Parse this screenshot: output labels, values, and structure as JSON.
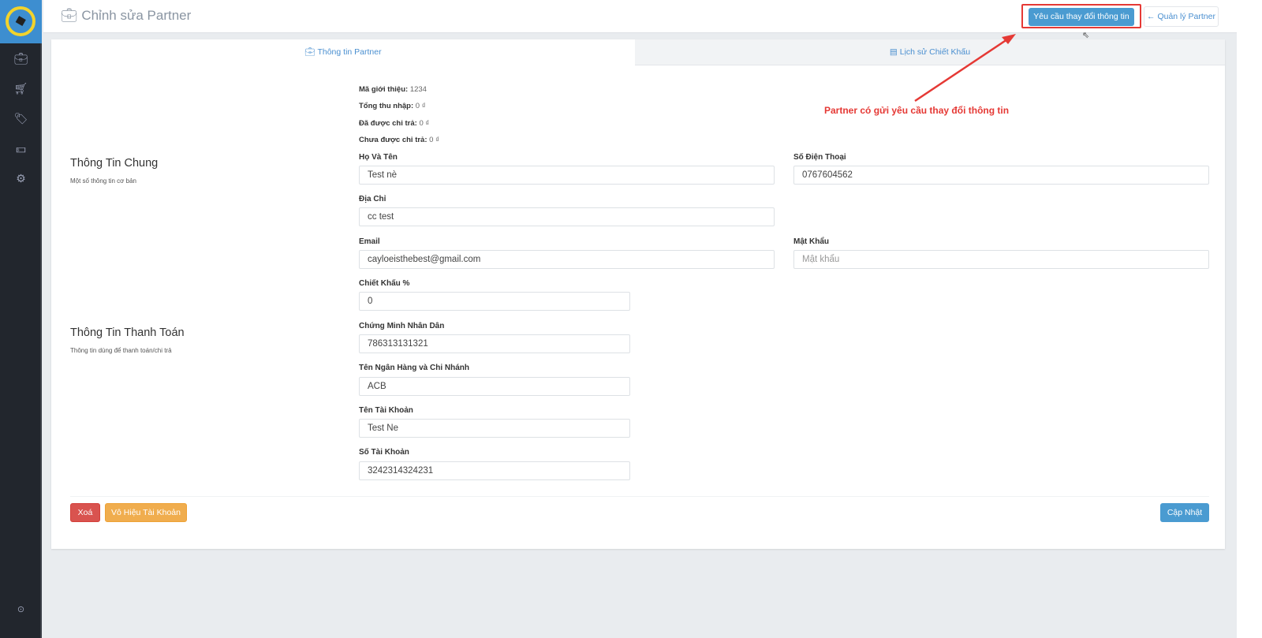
{
  "header": {
    "title": "Chỉnh sửa Partner",
    "request_button": "Yêu cầu thay đổi thông tin",
    "back_button": "Quản lý Partner"
  },
  "sidebar": {
    "items": [
      "briefcase-icon",
      "cart-icon",
      "tags-icon",
      "money-icon",
      "cogs-icon"
    ]
  },
  "tabs": [
    {
      "label": "Thông tin Partner"
    },
    {
      "label": "Lịch sử Chiết Khấu"
    }
  ],
  "annotation": "Partner có gửi yêu cầu thay đổi thông tin",
  "sections": {
    "general": {
      "title": "Thông Tin Chung",
      "subtitle": "Một số thông tin cơ bản"
    },
    "payment": {
      "title": "Thông Tin Thanh Toán",
      "subtitle": "Thông tin dùng để thanh toán/chi trả"
    }
  },
  "info": {
    "referral_label": "Mã giới thiệu:",
    "referral": "1234",
    "income_label": "Tổng thu nhập:",
    "income": "0 ₫",
    "paid_label": "Đã được chi trả:",
    "paid": "0 ₫",
    "unpaid_label": "Chưa được chi trả:",
    "unpaid": "0 ₫"
  },
  "fields": {
    "name": {
      "label": "Họ Và Tên",
      "value": "Test nè"
    },
    "phone": {
      "label": "Số Điện Thoại",
      "value": "0767604562"
    },
    "address": {
      "label": "Địa Chỉ",
      "value": "cc test"
    },
    "email": {
      "label": "Email",
      "value": "cayloeisthebest@gmail.com"
    },
    "password": {
      "label": "Mật Khẩu",
      "placeholder": "Mật khẩu"
    },
    "discount": {
      "label": "Chiết Khấu %",
      "value": "0"
    },
    "id_card": {
      "label": "Chứng Minh Nhân Dân",
      "value": "786313131321"
    },
    "bank": {
      "label": "Tên Ngân Hàng và Chi Nhánh",
      "value": "ACB"
    },
    "account_name": {
      "label": "Tên Tài Khoản",
      "value": "Test Ne"
    },
    "account_number": {
      "label": "Số Tài Khoản",
      "value": "3242314324231"
    }
  },
  "footer": {
    "delete": "Xoá",
    "disable": "Vô Hiệu Tài Khoản",
    "update": "Cập Nhật"
  }
}
